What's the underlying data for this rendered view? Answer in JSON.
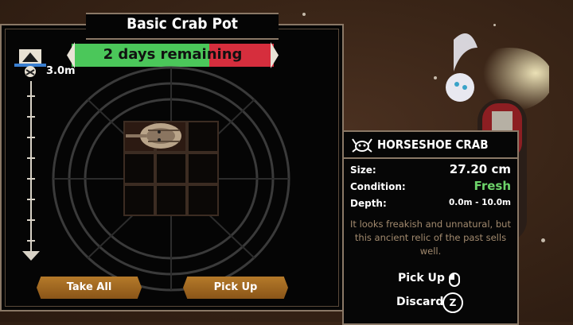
{
  "pot": {
    "title": "Basic Crab Pot",
    "timer_label": "2 days remaining",
    "timer_fraction": 0.68,
    "depth": "3.0m",
    "grid": {
      "rows": 3,
      "cols": 3,
      "occupied": [
        0,
        1
      ]
    }
  },
  "buttons": {
    "take_all": "Take All",
    "pick_up": "Pick Up"
  },
  "item": {
    "name": "HORSESHOE CRAB",
    "size_label": "Size:",
    "size_value": "27.20 cm",
    "condition_label": "Condition:",
    "condition_value": "Fresh",
    "depth_label": "Depth:",
    "depth_value": "0.0m - 10.0m",
    "description": "It looks freakish and unnatural, but this ancient relic of the past sells well.",
    "action_pickup": "Pick Up",
    "action_discard": "Discard",
    "discard_key": "Z"
  },
  "colors": {
    "fresh": "#6dd36a",
    "timer_green": "#4bc75a",
    "timer_red": "#d62e3d",
    "button": "#a8701f"
  }
}
